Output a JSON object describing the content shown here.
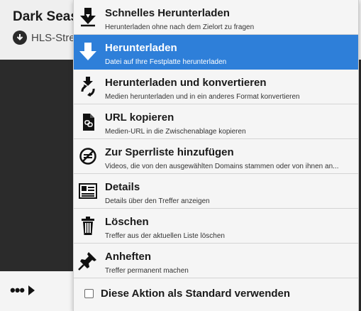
{
  "background": {
    "title": "Dark Seas",
    "subtitle": "HLS-Stre",
    "more_dots": "•••"
  },
  "menu": {
    "items": [
      {
        "title": "Schnelles Herunterladen",
        "desc": "Herunterladen ohne nach dem Zielort zu fragen",
        "icon": "quick-download-icon"
      },
      {
        "title": "Herunterladen",
        "desc": "Datei auf Ihre Festplatte herunterladen",
        "icon": "download-icon"
      },
      {
        "title": "Herunterladen und konvertieren",
        "desc": "Medien herunterladen und in ein anderes Format konvertieren",
        "icon": "download-convert-icon"
      },
      {
        "title": "URL kopieren",
        "desc": "Medien-URL in die Zwischenablage kopieren",
        "icon": "copy-url-icon"
      },
      {
        "title": "Zur Sperrliste hinzufügen",
        "desc": "Videos, die von den ausgewählten Domains stammen oder von ihnen an...",
        "icon": "blacklist-icon"
      },
      {
        "title": "Details",
        "desc": "Details über den Treffer anzeigen",
        "icon": "details-icon"
      },
      {
        "title": "Löschen",
        "desc": "Treffer aus der aktuellen Liste löschen",
        "icon": "trash-icon"
      },
      {
        "title": "Anheften",
        "desc": "Treffer permanent machen",
        "icon": "pin-icon"
      }
    ],
    "active_index": 1,
    "footer_label": "Diese Aktion als Standard verwenden",
    "footer_checked": false
  },
  "colors": {
    "highlight": "#2e7fd9",
    "menu_bg": "#f5f5f5"
  }
}
